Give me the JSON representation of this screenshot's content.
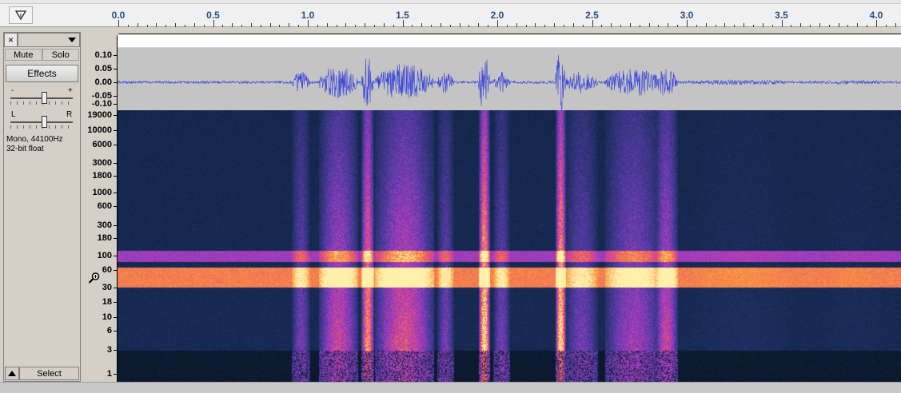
{
  "ruler": {
    "ticks": [
      "0.0",
      "0.5",
      "1.0",
      "1.5",
      "2.0",
      "2.5",
      "3.0",
      "3.5",
      "4.0"
    ]
  },
  "track": {
    "mute_label": "Mute",
    "solo_label": "Solo",
    "effects_label": "Effects",
    "gain_minus": "-",
    "gain_plus": "+",
    "pan_left": "L",
    "pan_right": "R",
    "info_rate": "Mono, 44100Hz",
    "info_format": "32-bit float",
    "select_label": "Select",
    "close_label": "×",
    "gain_level": 0.55,
    "pan_level": 0.55
  },
  "waveform_scale": [
    "0.10",
    "0.05",
    "0.00",
    "-0.05",
    "-0.10"
  ],
  "spectrogram_scale": [
    "19000",
    "10000",
    "6000",
    "3000",
    "1800",
    "1000",
    "600",
    "300",
    "180",
    "100",
    "60",
    "30",
    "18",
    "10",
    "6",
    "3",
    "1"
  ],
  "colors": {
    "waveform": "#3a46d8",
    "ruler_text": "#1f4e8c"
  },
  "icons": {
    "ruler_menu": "triangle-down-icon",
    "zoom": "magnifier-icon",
    "collapse": "triangle-up-icon",
    "dropdown": "chevron-down-icon"
  }
}
